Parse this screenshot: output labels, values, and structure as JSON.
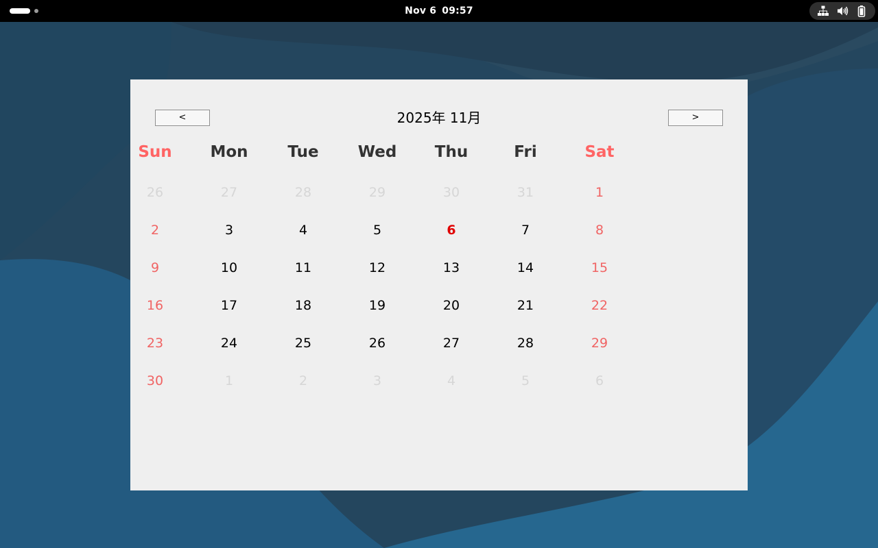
{
  "topbar": {
    "date": "Nov 6",
    "time": "09:57",
    "icons": [
      "network-wired-icon",
      "volume-icon",
      "battery-icon"
    ]
  },
  "calendar": {
    "prev_label": "<",
    "next_label": ">",
    "title": "2025年 11月",
    "weekdays": [
      "Sun",
      "Mon",
      "Tue",
      "Wed",
      "Thu",
      "Fri",
      "Sat"
    ],
    "today": 6,
    "weeks": [
      [
        {
          "day": "26",
          "other": true
        },
        {
          "day": "27",
          "other": true
        },
        {
          "day": "28",
          "other": true
        },
        {
          "day": "29",
          "other": true
        },
        {
          "day": "30",
          "other": true
        },
        {
          "day": "31",
          "other": true
        },
        {
          "day": "1",
          "other": false
        }
      ],
      [
        {
          "day": "2",
          "other": false
        },
        {
          "day": "3",
          "other": false
        },
        {
          "day": "4",
          "other": false
        },
        {
          "day": "5",
          "other": false
        },
        {
          "day": "6",
          "other": false
        },
        {
          "day": "7",
          "other": false
        },
        {
          "day": "8",
          "other": false
        }
      ],
      [
        {
          "day": "9",
          "other": false
        },
        {
          "day": "10",
          "other": false
        },
        {
          "day": "11",
          "other": false
        },
        {
          "day": "12",
          "other": false
        },
        {
          "day": "13",
          "other": false
        },
        {
          "day": "14",
          "other": false
        },
        {
          "day": "15",
          "other": false
        }
      ],
      [
        {
          "day": "16",
          "other": false
        },
        {
          "day": "17",
          "other": false
        },
        {
          "day": "18",
          "other": false
        },
        {
          "day": "19",
          "other": false
        },
        {
          "day": "20",
          "other": false
        },
        {
          "day": "21",
          "other": false
        },
        {
          "day": "22",
          "other": false
        }
      ],
      [
        {
          "day": "23",
          "other": false
        },
        {
          "day": "24",
          "other": false
        },
        {
          "day": "25",
          "other": false
        },
        {
          "day": "26",
          "other": false
        },
        {
          "day": "27",
          "other": false
        },
        {
          "day": "28",
          "other": false
        },
        {
          "day": "29",
          "other": false
        }
      ],
      [
        {
          "day": "30",
          "other": false
        },
        {
          "day": "1",
          "other": true
        },
        {
          "day": "2",
          "other": true
        },
        {
          "day": "3",
          "other": true
        },
        {
          "day": "4",
          "other": true
        },
        {
          "day": "5",
          "other": true
        },
        {
          "day": "6",
          "other": true
        }
      ]
    ]
  },
  "colors": {
    "weekend": "#f06464",
    "today": "#e00000",
    "other_month": "#d6d6d6",
    "window_bg": "#efefef",
    "topbar_bg": "#000000"
  }
}
